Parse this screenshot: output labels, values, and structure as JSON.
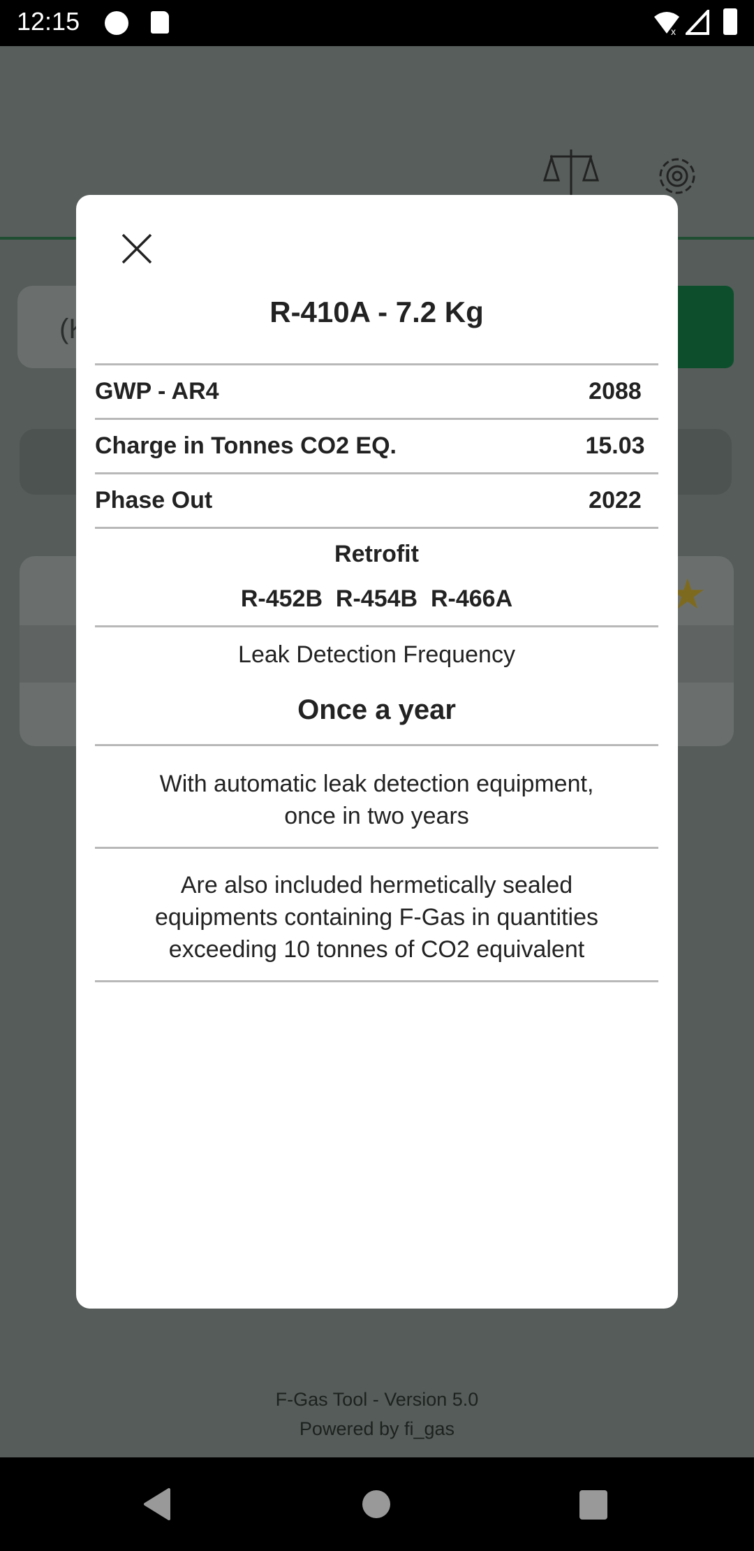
{
  "status_bar": {
    "time": "12:15"
  },
  "dialog": {
    "title": "R-410A - 7.2 Kg",
    "rows": [
      {
        "label": "GWP - AR4",
        "value": "2088"
      },
      {
        "label": "Charge in Tonnes CO2 EQ.",
        "value": "15.03"
      },
      {
        "label": "Phase Out",
        "value": "2022"
      }
    ],
    "retrofit_label": "Retrofit",
    "retrofit_values": "R-452B  R-454B  R-466A",
    "leak_label": "Leak Detection Frequency",
    "leak_value": "Once a year",
    "automatic_note": [
      "With automatic leak detection equipment,",
      "once in two years"
    ],
    "hermetic_note": [
      "Are also included hermetically sealed",
      "equipments containing F-Gas in quantities",
      "exceeding 10 tonnes of CO2 equivalent"
    ]
  },
  "background": {
    "input_partial_text": "(K"
  },
  "footer": {
    "version": "F-Gas Tool - Version 5.0",
    "powered": "Powered by fi_gas"
  },
  "colors": {
    "accent_green": "#0b6b35",
    "star": "#f0a500"
  }
}
